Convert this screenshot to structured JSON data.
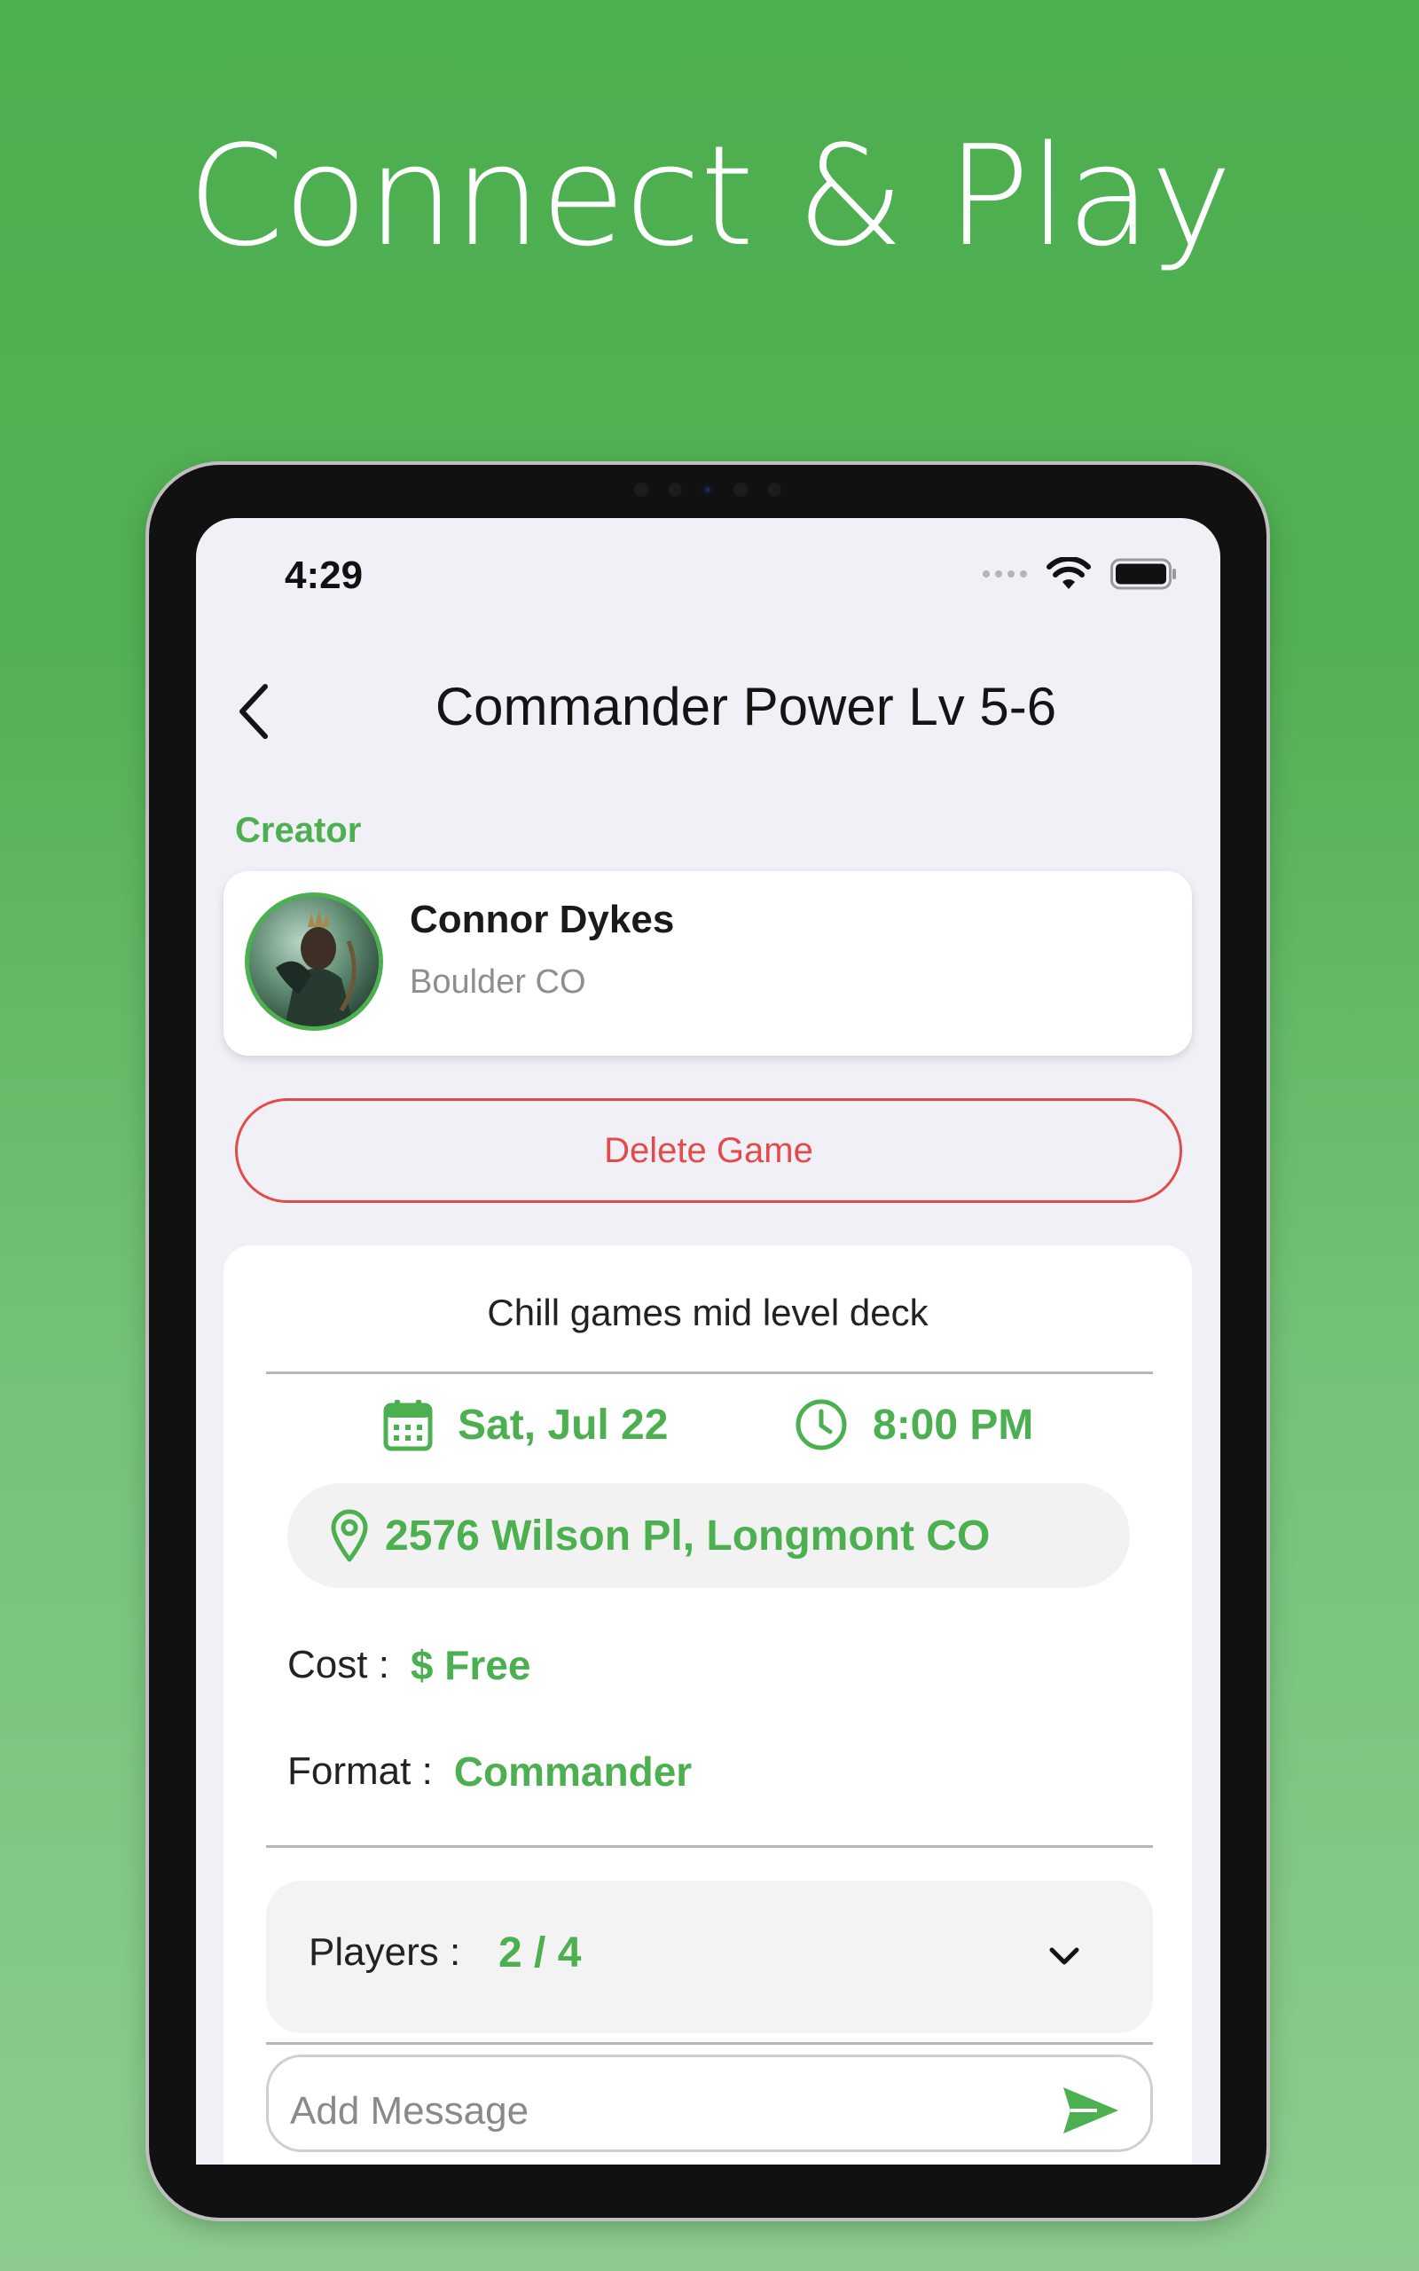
{
  "headline": "Connect & Play",
  "status_bar": {
    "time": "4:29"
  },
  "nav": {
    "title": "Commander Power Lv 5-6"
  },
  "creator": {
    "section_label": "Creator",
    "name": "Connor Dykes",
    "location": "Boulder CO"
  },
  "actions": {
    "delete_label": "Delete Game"
  },
  "game": {
    "description": "Chill games mid level deck",
    "date": "Sat, Jul 22",
    "time": "8:00 PM",
    "address": "2576 Wilson Pl, Longmont CO",
    "cost_label": "Cost :",
    "cost_value": "$ Free",
    "format_label": "Format :",
    "format_value": "Commander",
    "players_label": "Players :",
    "players_value": "2 / 4"
  },
  "message": {
    "placeholder": "Add Message"
  },
  "colors": {
    "accent": "#4caf50",
    "danger": "#e24b4b",
    "background_top": "#4caf50",
    "background_bottom": "#8dcc8e"
  },
  "icons": [
    "back-chevron-icon",
    "wifi-icon",
    "battery-icon",
    "calendar-icon",
    "clock-icon",
    "location-pin-icon",
    "chevron-down-icon",
    "send-icon"
  ]
}
